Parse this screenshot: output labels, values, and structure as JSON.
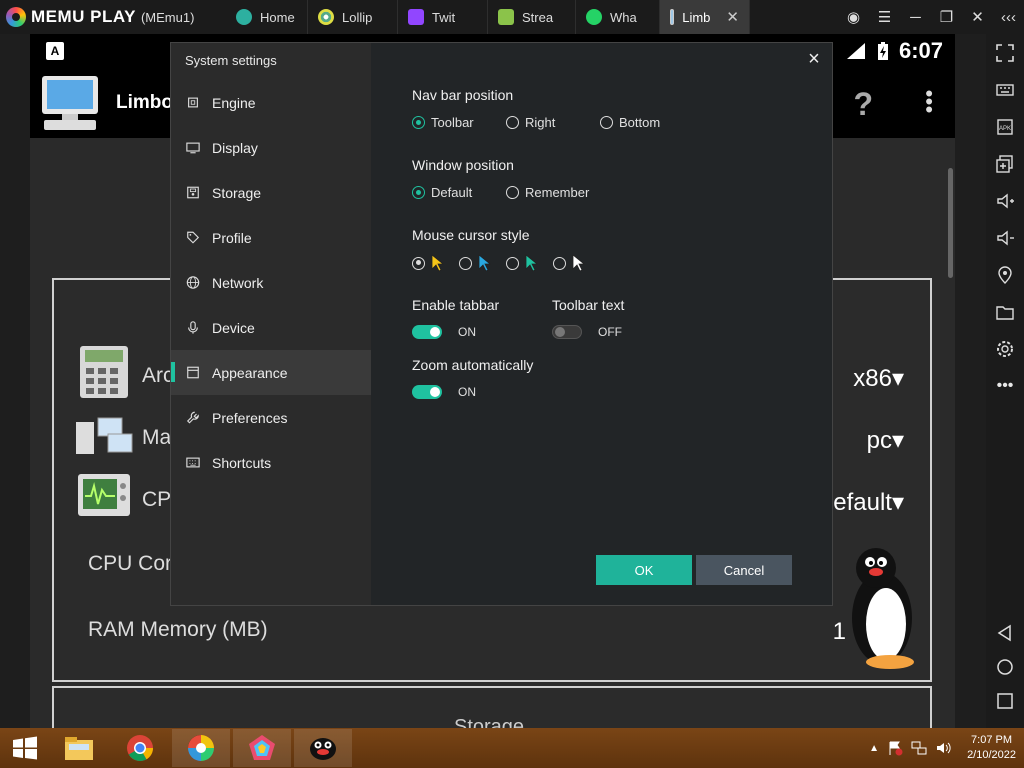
{
  "window": {
    "app_name": "MEMU PLAY",
    "instance": "(MEmu1)",
    "tabs": [
      {
        "label": "Home"
      },
      {
        "label": "Lollip"
      },
      {
        "label": "Twit"
      },
      {
        "label": "Strea"
      },
      {
        "label": "Wha"
      },
      {
        "label": "Limb",
        "active": true
      }
    ]
  },
  "android": {
    "status_icon": "A",
    "time": "6:07",
    "app_title": "Limbo",
    "help": "?",
    "rows": [
      {
        "label": "Arc",
        "value": "x86▾"
      },
      {
        "label": "Ma",
        "value": "pc▾"
      },
      {
        "label": "CP",
        "value": "efault▾"
      },
      {
        "label": "CPU Core",
        "value": ""
      },
      {
        "label": "RAM Memory (MB)",
        "value": "1"
      }
    ],
    "card2_label": "Storage"
  },
  "dialog": {
    "title": "System settings",
    "close": "×",
    "nav": [
      {
        "label": "Engine",
        "icon": "chip-icon"
      },
      {
        "label": "Display",
        "icon": "monitor-icon"
      },
      {
        "label": "Storage",
        "icon": "disk-icon"
      },
      {
        "label": "Profile",
        "icon": "tag-icon"
      },
      {
        "label": "Network",
        "icon": "globe-icon"
      },
      {
        "label": "Device",
        "icon": "mic-icon"
      },
      {
        "label": "Appearance",
        "icon": "window-icon",
        "active": true
      },
      {
        "label": "Preferences",
        "icon": "wrench-icon"
      },
      {
        "label": "Shortcuts",
        "icon": "keyboard-icon"
      }
    ],
    "nav_bar_position": {
      "label": "Nav bar position",
      "options": [
        "Toolbar",
        "Right",
        "Bottom"
      ],
      "selected": "Toolbar"
    },
    "window_position": {
      "label": "Window position",
      "options": [
        "Default",
        "Remember"
      ],
      "selected": "Default"
    },
    "mouse_cursor_style": {
      "label": "Mouse cursor style",
      "options": [
        "yellow-cursor-icon",
        "blue-cursor-icon",
        "teal-cursor-icon",
        "white-cursor-icon"
      ],
      "selected_index": 0
    },
    "enable_tabbar": {
      "label": "Enable tabbar",
      "state": "ON"
    },
    "toolbar_text": {
      "label": "Toolbar text",
      "state": "OFF"
    },
    "zoom_automatically": {
      "label": "Zoom automatically",
      "state": "ON"
    },
    "ok": "OK",
    "cancel": "Cancel"
  },
  "taskbar": {
    "time": "7:07 PM",
    "date": "2/10/2022"
  },
  "colors": {
    "accent": "#1fc2a0",
    "ok_button": "#1fb39a",
    "cancel_button": "#4a5560",
    "taskbar": "#6b3a10"
  }
}
